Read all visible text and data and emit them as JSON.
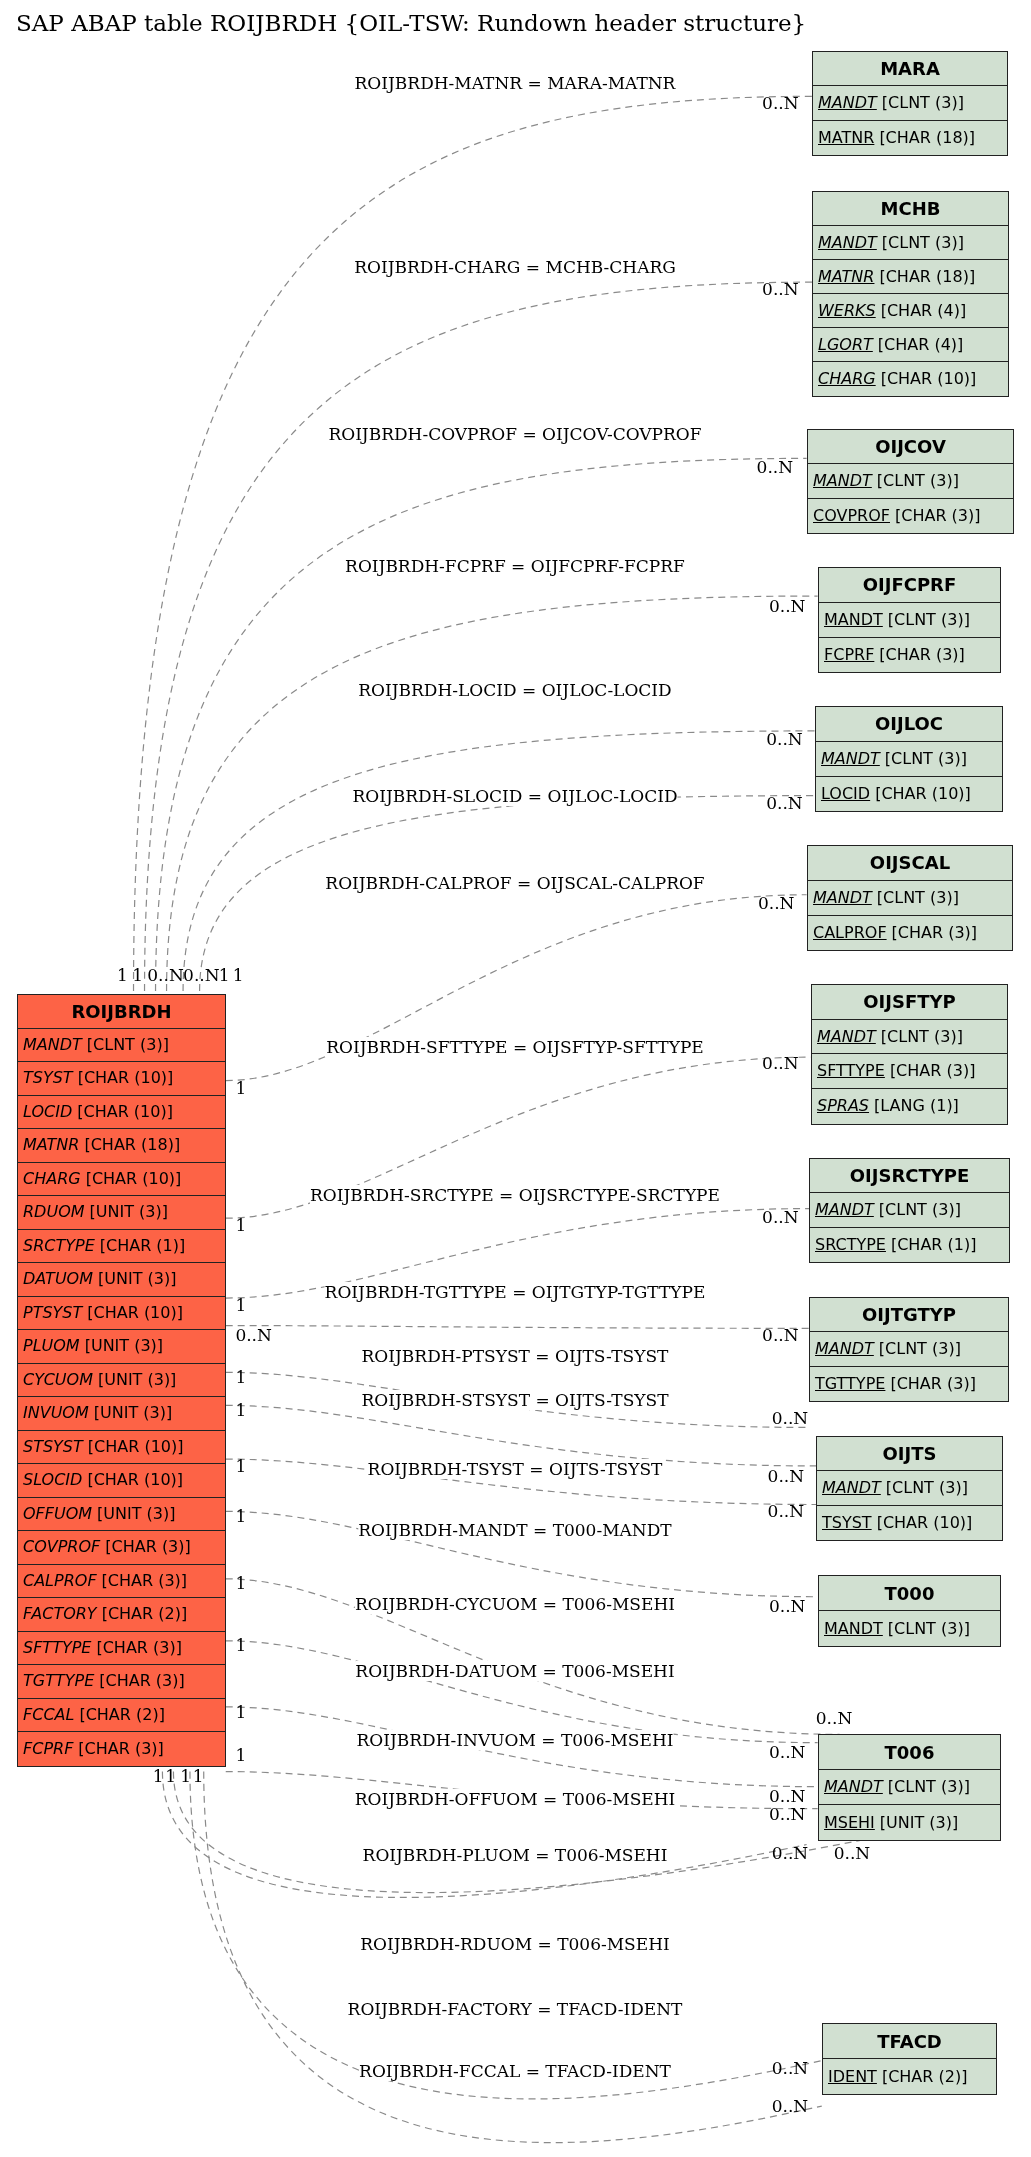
{
  "title": "SAP ABAP table ROIJBRDH {OIL-TSW: Rundown header structure}",
  "tables": [
    {
      "name": "ROIJBRDH",
      "color": "#fd6346",
      "fields": [
        {
          "name": "MANDT",
          "type": "[CLNT (3)]",
          "primary_key": false,
          "foreign_key": true
        },
        {
          "name": "TSYST",
          "type": "[CHAR (10)]",
          "primary_key": false,
          "foreign_key": true
        },
        {
          "name": "LOCID",
          "type": "[CHAR (10)]",
          "primary_key": false,
          "foreign_key": true
        },
        {
          "name": "MATNR",
          "type": "[CHAR (18)]",
          "primary_key": false,
          "foreign_key": true
        },
        {
          "name": "CHARG",
          "type": "[CHAR (10)]",
          "primary_key": false,
          "foreign_key": true
        },
        {
          "name": "RDUOM",
          "type": "[UNIT (3)]",
          "primary_key": false,
          "foreign_key": true
        },
        {
          "name": "SRCTYPE",
          "type": "[CHAR (1)]",
          "primary_key": false,
          "foreign_key": true
        },
        {
          "name": "DATUOM",
          "type": "[UNIT (3)]",
          "primary_key": false,
          "foreign_key": true
        },
        {
          "name": "PTSYST",
          "type": "[CHAR (10)]",
          "primary_key": false,
          "foreign_key": true
        },
        {
          "name": "PLUOM",
          "type": "[UNIT (3)]",
          "primary_key": false,
          "foreign_key": true
        },
        {
          "name": "CYCUOM",
          "type": "[UNIT (3)]",
          "primary_key": false,
          "foreign_key": true
        },
        {
          "name": "INVUOM",
          "type": "[UNIT (3)]",
          "primary_key": false,
          "foreign_key": true
        },
        {
          "name": "STSYST",
          "type": "[CHAR (10)]",
          "primary_key": false,
          "foreign_key": true
        },
        {
          "name": "SLOCID",
          "type": "[CHAR (10)]",
          "primary_key": false,
          "foreign_key": true
        },
        {
          "name": "OFFUOM",
          "type": "[UNIT (3)]",
          "primary_key": false,
          "foreign_key": true
        },
        {
          "name": "COVPROF",
          "type": "[CHAR (3)]",
          "primary_key": false,
          "foreign_key": true
        },
        {
          "name": "CALPROF",
          "type": "[CHAR (3)]",
          "primary_key": false,
          "foreign_key": true
        },
        {
          "name": "FACTORY",
          "type": "[CHAR (2)]",
          "primary_key": false,
          "foreign_key": true
        },
        {
          "name": "SFTTYPE",
          "type": "[CHAR (3)]",
          "primary_key": false,
          "foreign_key": true
        },
        {
          "name": "TGTTYPE",
          "type": "[CHAR (3)]",
          "primary_key": false,
          "foreign_key": true
        },
        {
          "name": "FCCAL",
          "type": "[CHAR (2)]",
          "primary_key": false,
          "foreign_key": true
        },
        {
          "name": "FCPRF",
          "type": "[CHAR (3)]",
          "primary_key": false,
          "foreign_key": true
        }
      ]
    },
    {
      "name": "MARA",
      "color": "#d1e0d1",
      "fields": [
        {
          "name": "MANDT",
          "type": "[CLNT (3)]",
          "primary_key": true,
          "foreign_key": true
        },
        {
          "name": "MATNR",
          "type": "[CHAR (18)]",
          "primary_key": true,
          "foreign_key": false
        }
      ]
    },
    {
      "name": "MCHB",
      "color": "#d1e0d1",
      "fields": [
        {
          "name": "MANDT",
          "type": "[CLNT (3)]",
          "primary_key": true,
          "foreign_key": true
        },
        {
          "name": "MATNR",
          "type": "[CHAR (18)]",
          "primary_key": true,
          "foreign_key": true
        },
        {
          "name": "WERKS",
          "type": "[CHAR (4)]",
          "primary_key": true,
          "foreign_key": true
        },
        {
          "name": "LGORT",
          "type": "[CHAR (4)]",
          "primary_key": true,
          "foreign_key": true
        },
        {
          "name": "CHARG",
          "type": "[CHAR (10)]",
          "primary_key": true,
          "foreign_key": true
        }
      ]
    },
    {
      "name": "OIJCOV",
      "color": "#d1e0d1",
      "fields": [
        {
          "name": "MANDT",
          "type": "[CLNT (3)]",
          "primary_key": true,
          "foreign_key": true
        },
        {
          "name": "COVPROF",
          "type": "[CHAR (3)]",
          "primary_key": true,
          "foreign_key": false
        }
      ]
    },
    {
      "name": "OIJFCPRF",
      "color": "#d1e0d1",
      "fields": [
        {
          "name": "MANDT",
          "type": "[CLNT (3)]",
          "primary_key": true,
          "foreign_key": false
        },
        {
          "name": "FCPRF",
          "type": "[CHAR (3)]",
          "primary_key": true,
          "foreign_key": false
        }
      ]
    },
    {
      "name": "OIJLOC",
      "color": "#d1e0d1",
      "fields": [
        {
          "name": "MANDT",
          "type": "[CLNT (3)]",
          "primary_key": true,
          "foreign_key": true
        },
        {
          "name": "LOCID",
          "type": "[CHAR (10)]",
          "primary_key": true,
          "foreign_key": false
        }
      ]
    },
    {
      "name": "OIJSCAL",
      "color": "#d1e0d1",
      "fields": [
        {
          "name": "MANDT",
          "type": "[CLNT (3)]",
          "primary_key": true,
          "foreign_key": true
        },
        {
          "name": "CALPROF",
          "type": "[CHAR (3)]",
          "primary_key": true,
          "foreign_key": false
        }
      ]
    },
    {
      "name": "OIJSFTYP",
      "color": "#d1e0d1",
      "fields": [
        {
          "name": "MANDT",
          "type": "[CLNT (3)]",
          "primary_key": true,
          "foreign_key": true
        },
        {
          "name": "SFTTYPE",
          "type": "[CHAR (3)]",
          "primary_key": true,
          "foreign_key": false
        },
        {
          "name": "SPRAS",
          "type": "[LANG (1)]",
          "primary_key": true,
          "foreign_key": true
        }
      ]
    },
    {
      "name": "OIJSRCTYPE",
      "color": "#d1e0d1",
      "fields": [
        {
          "name": "MANDT",
          "type": "[CLNT (3)]",
          "primary_key": true,
          "foreign_key": true
        },
        {
          "name": "SRCTYPE",
          "type": "[CHAR (1)]",
          "primary_key": true,
          "foreign_key": false
        }
      ]
    },
    {
      "name": "OIJTGTYP",
      "color": "#d1e0d1",
      "fields": [
        {
          "name": "MANDT",
          "type": "[CLNT (3)]",
          "primary_key": true,
          "foreign_key": true
        },
        {
          "name": "TGTTYPE",
          "type": "[CHAR (3)]",
          "primary_key": true,
          "foreign_key": false
        }
      ]
    },
    {
      "name": "OIJTS",
      "color": "#d1e0d1",
      "fields": [
        {
          "name": "MANDT",
          "type": "[CLNT (3)]",
          "primary_key": true,
          "foreign_key": true
        },
        {
          "name": "TSYST",
          "type": "[CHAR (10)]",
          "primary_key": true,
          "foreign_key": false
        }
      ]
    },
    {
      "name": "T000",
      "color": "#d1e0d1",
      "fields": [
        {
          "name": "MANDT",
          "type": "[CLNT (3)]",
          "primary_key": true,
          "foreign_key": false
        }
      ]
    },
    {
      "name": "T006",
      "color": "#d1e0d1",
      "fields": [
        {
          "name": "MANDT",
          "type": "[CLNT (3)]",
          "primary_key": true,
          "foreign_key": true
        },
        {
          "name": "MSEHI",
          "type": "[UNIT (3)]",
          "primary_key": true,
          "foreign_key": false
        }
      ]
    },
    {
      "name": "TFACD",
      "color": "#d1e0d1",
      "fields": [
        {
          "name": "IDENT",
          "type": "[CHAR (2)]",
          "primary_key": true,
          "foreign_key": false
        }
      ]
    }
  ],
  "relations": [
    {
      "label": "ROIJBRDH-MATNR = MARA-MATNR",
      "left_card": "1",
      "right_card": "0..N"
    },
    {
      "label": "ROIJBRDH-CHARG = MCHB-CHARG",
      "left_card": "1",
      "right_card": "0..N"
    },
    {
      "label": "ROIJBRDH-COVPROF = OIJCOV-COVPROF",
      "left_card": "0..N",
      "right_card": "0..N"
    },
    {
      "label": "ROIJBRDH-FCPRF = OIJFCPRF-FCPRF",
      "left_card": "0..N",
      "right_card": "0..N"
    },
    {
      "label": "ROIJBRDH-LOCID = OIJLOC-LOCID",
      "left_card": "1",
      "right_card": "0..N"
    },
    {
      "label": "ROIJBRDH-SLOCID = OIJLOC-LOCID",
      "left_card": "1",
      "right_card": "0..N"
    },
    {
      "label": "ROIJBRDH-CALPROF = OIJSCAL-CALPROF",
      "left_card": "1",
      "right_card": "0..N"
    },
    {
      "label": "ROIJBRDH-SFTTYPE = OIJSFTYP-SFTTYPE",
      "left_card": "1",
      "right_card": "0..N"
    },
    {
      "label": "ROIJBRDH-SRCTYPE = OIJSRCTYPE-SRCTYPE",
      "left_card": "1",
      "right_card": "0..N"
    },
    {
      "label": "ROIJBRDH-TGTTYPE = OIJTGTYP-TGTTYPE",
      "left_card": "0..N",
      "right_card": "0..N"
    },
    {
      "label": "ROIJBRDH-PTSYST = OIJTS-TSYST",
      "left_card": "1",
      "right_card": "0..N"
    },
    {
      "label": "ROIJBRDH-STSYST = OIJTS-TSYST",
      "left_card": "1",
      "right_card": "0..N"
    },
    {
      "label": "ROIJBRDH-TSYST = OIJTS-TSYST",
      "left_card": "1",
      "right_card": "0..N"
    },
    {
      "label": "ROIJBRDH-MANDT = T000-MANDT",
      "left_card": "1",
      "right_card": "0..N"
    },
    {
      "label": "ROIJBRDH-CYCUOM = T006-MSEHI",
      "left_card": "1",
      "right_card": "0..N"
    },
    {
      "label": "ROIJBRDH-DATUOM = T006-MSEHI",
      "left_card": "1",
      "right_card": "0..N"
    },
    {
      "label": "ROIJBRDH-INVUOM = T006-MSEHI",
      "left_card": "1",
      "right_card": "0..N"
    },
    {
      "label": "ROIJBRDH-OFFUOM = T006-MSEHI",
      "left_card": "1",
      "right_card": "0..N"
    },
    {
      "label": "ROIJBRDH-PLUOM = T006-MSEHI",
      "left_card": "1",
      "right_card": "0..N"
    },
    {
      "label": "ROIJBRDH-RDUOM = T006-MSEHI",
      "left_card": "1",
      "right_card": "0..N"
    },
    {
      "label": "ROIJBRDH-FACTORY = TFACD-IDENT",
      "left_card": "1",
      "right_card": "0..N"
    },
    {
      "label": "ROIJBRDH-FCCAL = TFACD-IDENT",
      "left_card": "1",
      "right_card": "0..N"
    }
  ]
}
